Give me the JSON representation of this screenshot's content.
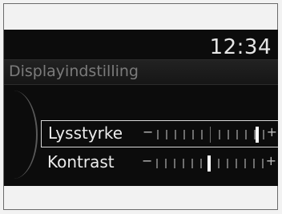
{
  "status": {
    "time": "12:34"
  },
  "menu": {
    "title": "Displayindstilling",
    "items": [
      {
        "label": "Lysstyrke",
        "selected": true,
        "level": 0.95,
        "minus": "−",
        "plus": "+"
      },
      {
        "label": "Kontrast",
        "selected": false,
        "level": 0.5,
        "minus": "−",
        "plus": "+"
      }
    ]
  },
  "colors": {
    "screen_bg": "#0c0c0c",
    "text": "#ececec",
    "tick": "#6e6e6e",
    "thumb": "#ffffff"
  }
}
